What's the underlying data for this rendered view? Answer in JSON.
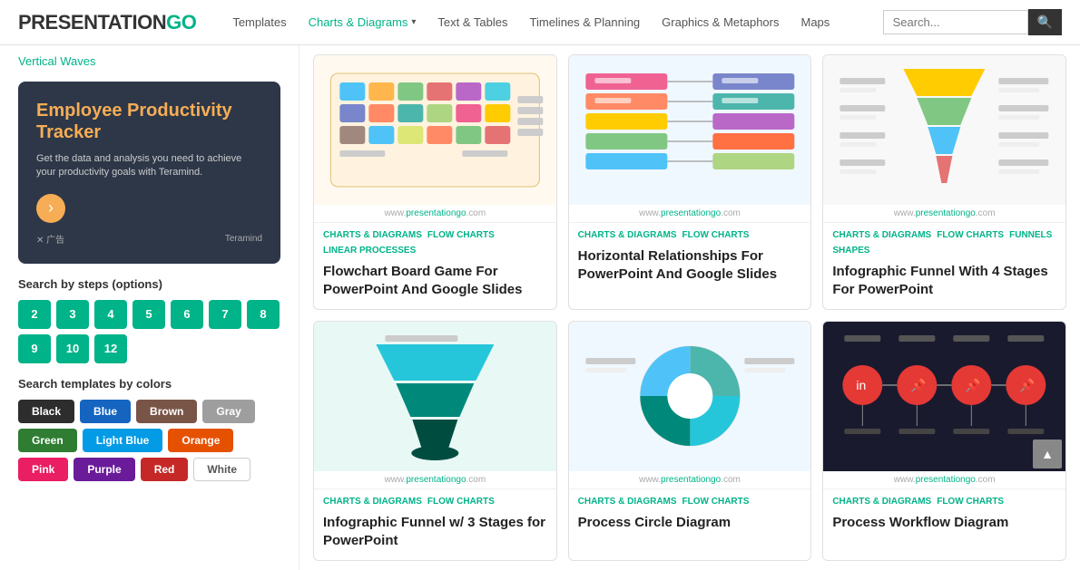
{
  "header": {
    "logo_text": "PRESENTATIONGO",
    "logo_highlight": "GO",
    "nav": [
      {
        "label": "Templates",
        "active": false
      },
      {
        "label": "Charts & Diagrams",
        "active": true,
        "has_dropdown": true
      },
      {
        "label": "Text & Tables",
        "active": false
      },
      {
        "label": "Timelines & Planning",
        "active": false
      },
      {
        "label": "Graphics & Metaphors",
        "active": false
      },
      {
        "label": "Maps",
        "active": false
      }
    ],
    "search_placeholder": "Search..."
  },
  "sidebar": {
    "vertical_waves_link": "Vertical Waves",
    "ad": {
      "title": "Employee Productivity Tracker",
      "description": "Get the data and analysis you need to achieve your productivity goals with Teramind.",
      "footer_label": "✕ 广告",
      "brand": "Teramind"
    },
    "steps_section": "Search by steps (options)",
    "steps": [
      "2",
      "3",
      "4",
      "5",
      "6",
      "7",
      "8",
      "9",
      "10",
      "12"
    ],
    "colors_section": "Search templates by colors",
    "colors": [
      {
        "label": "Black",
        "bg": "#2d2d2d",
        "text": "#fff"
      },
      {
        "label": "Blue",
        "bg": "#1565c0",
        "text": "#fff"
      },
      {
        "label": "Brown",
        "bg": "#795548",
        "text": "#fff"
      },
      {
        "label": "Gray",
        "bg": "#9e9e9e",
        "text": "#fff"
      },
      {
        "label": "Green",
        "bg": "#2e7d32",
        "text": "#fff"
      },
      {
        "label": "Light Blue",
        "bg": "#039be5",
        "text": "#fff"
      },
      {
        "label": "Orange",
        "bg": "#e65100",
        "text": "#fff"
      },
      {
        "label": "Pink",
        "bg": "#e91e63",
        "text": "#fff"
      },
      {
        "label": "Purple",
        "bg": "#6a1b9a",
        "text": "#fff"
      },
      {
        "label": "Red",
        "bg": "#c62828",
        "text": "#fff"
      },
      {
        "label": "White",
        "bg": "#ffffff",
        "text": "#555",
        "border": "#ccc"
      }
    ]
  },
  "cards": [
    {
      "source": "www.presentationgo.com",
      "tags": [
        "CHARTS & DIAGRAMS",
        "FLOW CHARTS",
        "LINEAR PROCESSES"
      ],
      "title": "Flowchart Board Game For PowerPoint And Google Slides",
      "img_type": "flowchart"
    },
    {
      "source": "www.presentationgo.com",
      "tags": [
        "CHARTS & DIAGRAMS",
        "FLOW CHARTS"
      ],
      "title": "Horizontal Relationships For PowerPoint And Google Slides",
      "img_type": "horiz"
    },
    {
      "source": "www.presentationgo.com",
      "tags": [
        "CHARTS & DIAGRAMS",
        "FLOW CHARTS",
        "FUNNELS",
        "SHAPES"
      ],
      "title": "Infographic Funnel With 4 Stages For PowerPoint",
      "img_type": "funnel4"
    },
    {
      "source": "www.presentationgo.com",
      "tags": [
        "CHARTS & DIAGRAMS",
        "FLOW CHARTS"
      ],
      "title": "Infographic Funnel w/ 3 Stages for PowerPoint",
      "img_type": "funnel3"
    },
    {
      "source": "www.presentationgo.com",
      "tags": [
        "CHARTS & DIAGRAMS",
        "FLOW CHARTS"
      ],
      "title": "Process Circle Diagram",
      "img_type": "circle"
    },
    {
      "source": "www.presentationgo.com",
      "tags": [
        "CHARTS & DIAGRAMS",
        "FLOW CHARTS"
      ],
      "title": "Process Workflow Diagram",
      "img_type": "workflow"
    }
  ]
}
